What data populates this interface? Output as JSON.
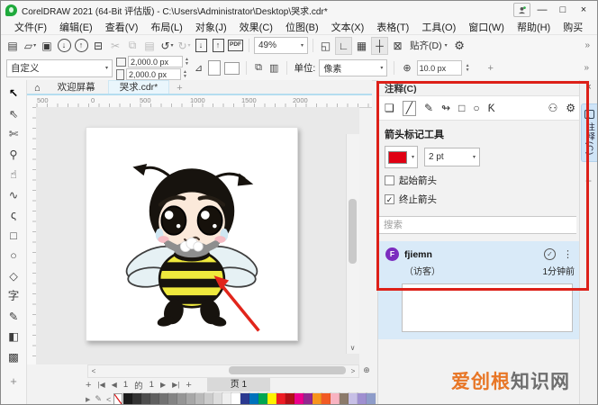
{
  "titlebar": {
    "title": "CorelDRAW 2021 (64-Bit 评估版) - C:\\Users\\Administrator\\Desktop\\哭求.cdr*",
    "minimize_glyph": "—",
    "maximize_glyph": "□",
    "close_glyph": "×"
  },
  "menu": {
    "items": [
      "文件(F)",
      "编辑(E)",
      "查看(V)",
      "布局(L)",
      "对象(J)",
      "效果(C)",
      "位图(B)",
      "文本(X)",
      "表格(T)",
      "工具(O)",
      "窗口(W)",
      "帮助(H)",
      "购买"
    ]
  },
  "toolbar": {
    "left": [
      {
        "name": "new-document-button",
        "glyph": "▤"
      },
      {
        "name": "open-button",
        "glyph": "▱",
        "caret": "▾"
      },
      {
        "name": "save-button",
        "glyph": "▣"
      },
      {
        "name": "cloud-download-button",
        "glyph": "↓",
        "circle": true
      },
      {
        "name": "cloud-upload-button",
        "glyph": "↑",
        "circle": true
      },
      {
        "name": "print-button",
        "glyph": "⊟"
      },
      {
        "name": "cut-button",
        "glyph": "✂",
        "disabled": true
      },
      {
        "name": "copy-button",
        "glyph": "⧉",
        "disabled": true
      },
      {
        "name": "paste-button",
        "glyph": "▤",
        "disabled": true
      },
      {
        "name": "undo-button",
        "glyph": "↺",
        "caret": "▾"
      },
      {
        "name": "redo-button",
        "glyph": "↻",
        "caret": "▾",
        "disabled": true
      },
      {
        "name": "import-button",
        "glyph": "↓",
        "boxed": true
      },
      {
        "name": "export-button",
        "glyph": "↑",
        "boxed": true
      },
      {
        "name": "publish-pdf-button",
        "glyph": "PDF",
        "pdf": true
      }
    ],
    "zoom_value": "49%",
    "right": [
      {
        "name": "full-screen-preview-button",
        "glyph": "◱"
      },
      {
        "name": "show-rulers-button",
        "glyph": "∟",
        "active": true
      },
      {
        "name": "show-grid-button",
        "glyph": "▦"
      },
      {
        "name": "show-guidelines-button",
        "glyph": "┼",
        "active": true
      },
      {
        "name": "snap-off-button",
        "glyph": "⊠"
      }
    ],
    "snap_label": "贴齐(D)",
    "options_glyph": "⚙",
    "overflow_glyph": "»"
  },
  "propertybar": {
    "preset": "自定义",
    "page_width": "2,000.0 px",
    "page_height": "2,000.0 px",
    "angle_glyph": "⊿",
    "pages_glyph_1": "⧉",
    "pages_glyph_2": "▥",
    "units_label": "单位:",
    "units_value": "像素",
    "nudge_glyph": "⊕",
    "nudge_value": "10.0 px",
    "add_glyph": "+",
    "overflow_glyph": "»"
  },
  "doctabs": {
    "home_glyph": "⌂",
    "welcome": "欢迎屏幕",
    "document": "哭求.cdr*",
    "add_glyph": "+"
  },
  "ruler": {
    "labels": [
      "500",
      "0",
      "500",
      "1000",
      "1500",
      "2000"
    ]
  },
  "toolbox": {
    "tools": [
      {
        "name": "pick-tool",
        "glyph": "↖",
        "active": true
      },
      {
        "name": "shape-tool",
        "glyph": "⇖"
      },
      {
        "name": "crop-tool",
        "glyph": "✄"
      },
      {
        "name": "zoom-tool",
        "glyph": "⚲"
      },
      {
        "name": "pan-tool",
        "glyph": "☝"
      },
      {
        "name": "freehand-tool",
        "glyph": "∿"
      },
      {
        "name": "artistic-media-tool",
        "glyph": "ς"
      },
      {
        "name": "rectangle-tool",
        "glyph": "□"
      },
      {
        "name": "ellipse-tool",
        "glyph": "○"
      },
      {
        "name": "polygon-tool",
        "glyph": "◇"
      },
      {
        "name": "text-tool",
        "glyph": "字"
      },
      {
        "name": "eyedropper-tool",
        "glyph": "✎"
      },
      {
        "name": "interactive-fill-tool",
        "glyph": "◧"
      },
      {
        "name": "mesh-fill-tool",
        "glyph": "▩"
      }
    ],
    "add_glyph": "+"
  },
  "scrollbars": {
    "left_glyph": "<",
    "right_glyph": ">",
    "down_glyph": "∨",
    "zoom_glyph": "⊕"
  },
  "pager": {
    "add_left": "+",
    "first": "|◀",
    "prev": "◀",
    "current": "1",
    "of": "的",
    "total": "1",
    "next": "▶",
    "last": "▶|",
    "add_right": "+",
    "page_tab": "页 1"
  },
  "palette": {
    "flyout_glyph": "▶",
    "eyedropper_glyph": "✎",
    "scroll_left_glyph": "<",
    "scroll_right_glyph": ">",
    "overflow_glyph": "»",
    "colors": [
      "#1b1b1b",
      "#333333",
      "#4d4d4d",
      "#5f5f5f",
      "#717171",
      "#838383",
      "#959595",
      "#a7a7a7",
      "#b9b9b9",
      "#cbcbcb",
      "#dddddd",
      "#efefef",
      "#ffffff",
      "#2b3990",
      "#0072bc",
      "#00a651",
      "#fff200",
      "#ed1c24",
      "#b11016",
      "#ec008c",
      "#92278f",
      "#f7941d",
      "#f15a24",
      "#f8b3c1",
      "#8c7b6b",
      "#c7bfe6",
      "#9f8fd0",
      "#8e9cc9"
    ]
  },
  "comments": {
    "title": "注释(C)",
    "tools": [
      {
        "name": "add-note-icon",
        "glyph": "❏"
      },
      {
        "name": "arrow-line-tool-icon",
        "glyph": "╱",
        "selected": true
      },
      {
        "name": "pen-tool-icon",
        "glyph": "✎"
      },
      {
        "name": "marker-tool-icon",
        "glyph": "↬"
      },
      {
        "name": "rectangle-note-tool-icon",
        "glyph": "□"
      },
      {
        "name": "ellipse-note-tool-icon",
        "glyph": "○"
      },
      {
        "name": "polyline-note-tool-icon",
        "glyph": "Ƙ"
      },
      {
        "name": "collaboration-icon",
        "glyph": "⚇",
        "push": true
      },
      {
        "name": "comments-settings-gear-icon",
        "glyph": "⚙"
      }
    ],
    "section_title": "箭头标记工具",
    "stroke_color": "#e00013",
    "swatch_style": "background:#e00013",
    "swatch_caret": "▾",
    "stroke_width": "2 pt",
    "start_arrow_label": "起始箭头",
    "end_arrow_label": "终止箭头",
    "check_glyph": "✓",
    "search_placeholder": "搜索",
    "comment": {
      "avatar_initial": "F",
      "user": "fjiemn",
      "verify_glyph": "✓",
      "menu_glyph": "⋮",
      "role": "（访客）",
      "time": "1分钟前"
    }
  },
  "sidestrip": {
    "close_glyph": "×",
    "tab_label": "注释(C)",
    "add_glyph": "+"
  },
  "watermark": {
    "orange": "爱创根",
    "gray": "知识网"
  },
  "accent": {
    "annotation_red": "#dd2018",
    "frame_style": "border-color:#dd2018"
  }
}
